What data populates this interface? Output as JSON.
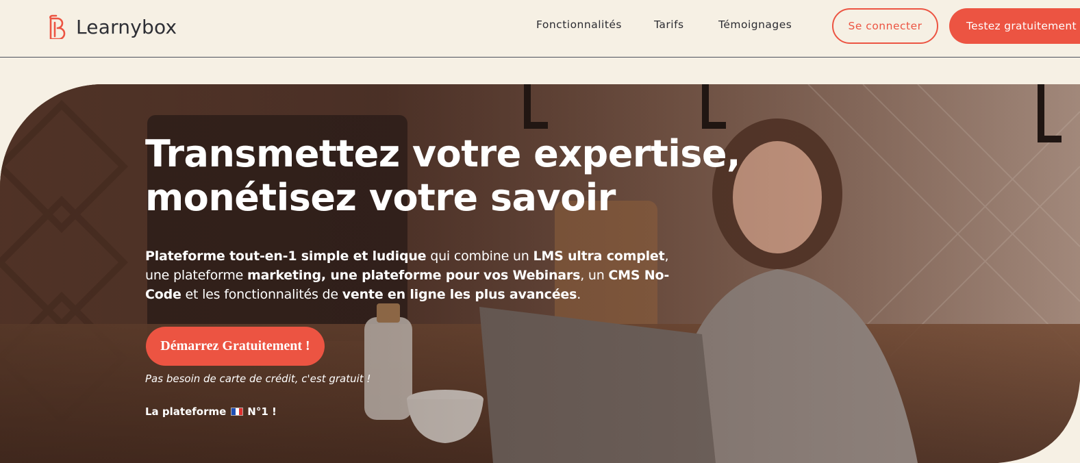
{
  "brand": {
    "name": "Learnybox",
    "accent_color": "#ec5442",
    "header_bg": "#f6f0e4"
  },
  "nav": {
    "items": [
      "Fonctionnalités",
      "Tarifs",
      "Témoignages"
    ],
    "login_label": "Se connecter",
    "trial_label": "Testez gratuitement"
  },
  "hero": {
    "title_line1": "Transmettez votre expertise,",
    "title_line2": "monétisez votre savoir",
    "description": [
      {
        "text": "Plateforme tout-en-1 simple et ludique",
        "bold": true
      },
      {
        "text": " qui combine un ",
        "bold": false
      },
      {
        "text": "LMS ultra complet",
        "bold": true
      },
      {
        "text": ", une plateforme ",
        "bold": false
      },
      {
        "text": "marketing, une plateforme pour vos Webinars",
        "bold": true
      },
      {
        "text": ", un ",
        "bold": false
      },
      {
        "text": "CMS No-Code",
        "bold": true
      },
      {
        "text": " et les fonctionnalités de ",
        "bold": false
      },
      {
        "text": "vente en ligne les plus avancées",
        "bold": true
      },
      {
        "text": ".",
        "bold": false
      }
    ],
    "cta_label": "Démarrez Gratuitement !",
    "note": "Pas besoin de carte de crédit, c'est gratuit !",
    "tagline_prefix": "La plateforme",
    "tagline_flag": "france-flag-icon",
    "tagline_suffix": "N°1 !"
  }
}
